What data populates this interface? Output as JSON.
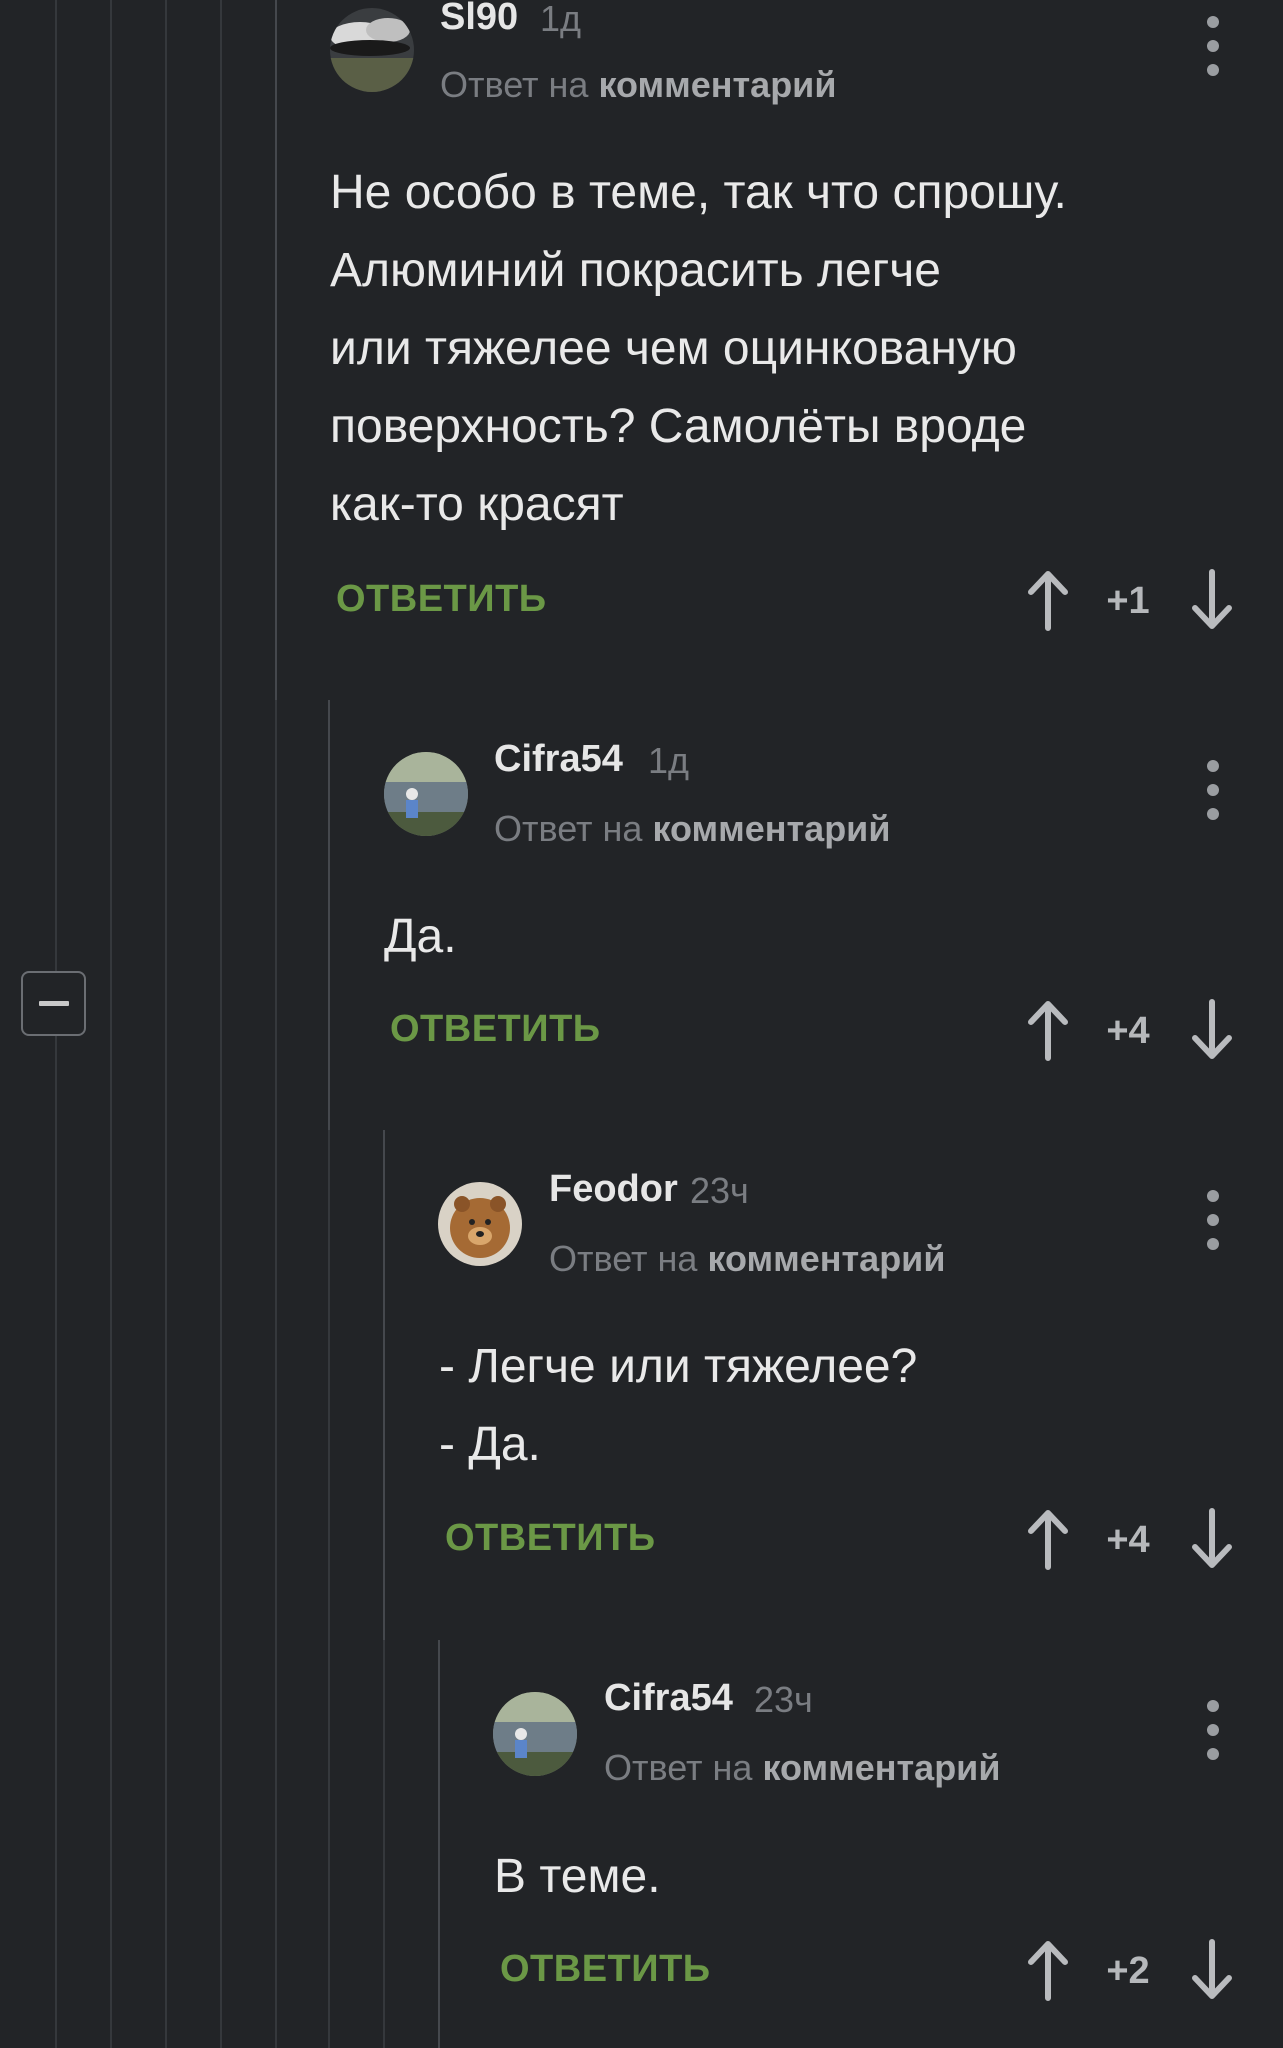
{
  "comments": [
    {
      "username": "Sl90",
      "time": "1д",
      "reply_prefix": "Ответ на",
      "reply_link": "комментарий",
      "text": "Не особо в теме, так что спрошу.\nАлюминий покрасить легче\nили тяжелее чем оцинкованую\nповерхность? Самолёты вроде\nкак-то красят",
      "reply_label": "ОТВЕТИТЬ",
      "score": "+1"
    },
    {
      "username": "Cifra54",
      "time": "1д",
      "reply_prefix": "Ответ на",
      "reply_link": "комментарий",
      "text": "Да.",
      "reply_label": "ОТВЕТИТЬ",
      "score": "+4"
    },
    {
      "username": "Feodor",
      "time": "23ч",
      "reply_prefix": "Ответ на",
      "reply_link": "комментарий",
      "text": "- Легче или тяжелее?\n- Да.",
      "reply_label": "ОТВЕТИТЬ",
      "score": "+4"
    },
    {
      "username": "Cifra54",
      "time": "23ч",
      "reply_prefix": "Ответ на",
      "reply_link": "комментарий",
      "text": "В теме.",
      "reply_label": "ОТВЕТИТЬ",
      "score": "+2"
    }
  ],
  "colors": {
    "background": "#222427",
    "reply_button": "#6b9846",
    "thread_line": "#35383c"
  },
  "icons": {
    "collapse": "minus-square-icon",
    "menu": "vertical-dots-icon",
    "upvote": "arrow-up-icon",
    "downvote": "arrow-down-icon"
  }
}
